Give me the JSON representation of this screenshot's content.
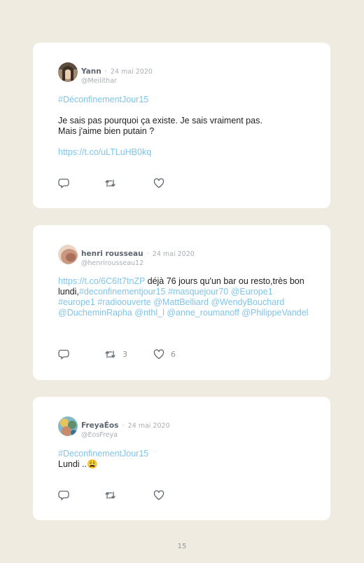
{
  "tweets": [
    {
      "author": "Yann",
      "sep": "·",
      "date": "24 mai 2020",
      "handle": "@Meilithar",
      "hashtag": "#DéconfinementJour15",
      "line1": "Je sais pas pourquoi ça existe. Je sais vraiment pas.",
      "line2": "Mais j'aime bien putain ?",
      "url": "https://t.co/uLTLuHB0kq",
      "retweets": "",
      "likes": ""
    },
    {
      "author": "henri rousseau",
      "sep": "·",
      "date": "24 mai 2020",
      "handle": "@henrirousseau12",
      "url": "https://t.co/6C6It7tnZP",
      "text1": " déjà 76 jours qu'un bar ou resto,très bon lundi,",
      "tags1": "#deconfinementjour15 #masquejour70 @Europe1 #europe1 #radioouverte @MattBelliard @WendyBouchard @DucheminRapha @nthl_l @anne_roumanoff @PhilippeVandel",
      "retweets": "3",
      "likes": "6"
    },
    {
      "author": "FreyaÉos",
      "sep": "·",
      "date": "24 mai 2020",
      "handle": "@EosFreya",
      "hashtag": "#DeconfinementJour15",
      "text": "Lundi ..😩",
      "retweets": "",
      "likes": ""
    }
  ],
  "icons": [
    "reply-icon",
    "retweet-icon",
    "like-icon"
  ],
  "page_number": "15"
}
